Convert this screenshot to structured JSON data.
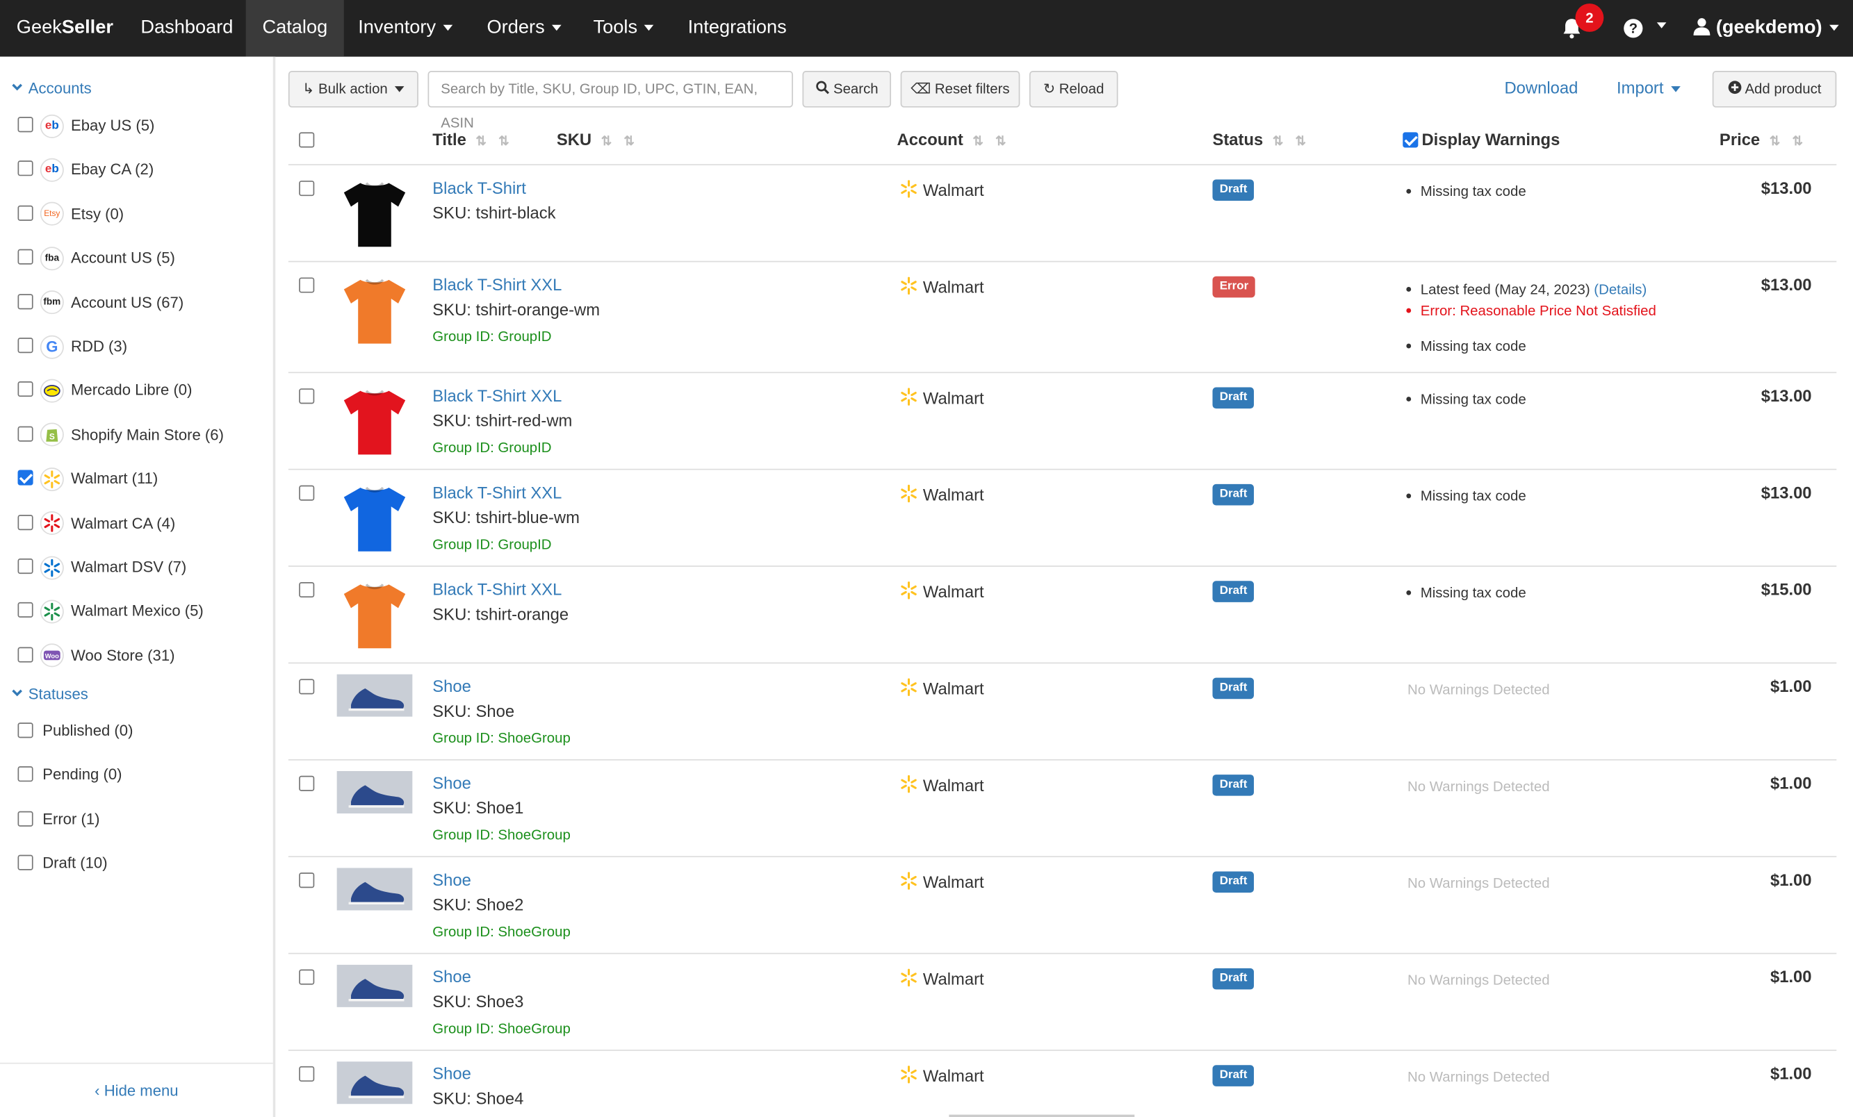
{
  "brand": {
    "part1": "Geek",
    "part2": "Seller"
  },
  "nav": {
    "dashboard": "Dashboard",
    "catalog": "Catalog",
    "inventory": "Inventory",
    "orders": "Orders",
    "tools": "Tools",
    "integrations": "Integrations"
  },
  "notifications": {
    "count": "2"
  },
  "help_icon": "?",
  "user": {
    "name": "(geekdemo)"
  },
  "sidebar": {
    "accounts_heading": "Accounts",
    "accounts": [
      {
        "label": "Ebay US (5)",
        "icon": "ebay-icon",
        "logo_text": "eb",
        "checked": false
      },
      {
        "label": "Ebay CA (2)",
        "icon": "ebay-icon",
        "logo_text": "eb",
        "checked": false
      },
      {
        "label": "Etsy (0)",
        "icon": "etsy-icon",
        "logo_text": "Etsy",
        "checked": false
      },
      {
        "label": "Account US (5)",
        "icon": "fba-icon",
        "logo_text": "fba",
        "checked": false
      },
      {
        "label": "Account US (67)",
        "icon": "fbm-icon",
        "logo_text": "fbm",
        "checked": false
      },
      {
        "label": "RDD (3)",
        "icon": "google-icon",
        "logo_text": "G",
        "checked": false
      },
      {
        "label": "Mercado Libre (0)",
        "icon": "mercado-libre-icon",
        "logo_text": "",
        "checked": false
      },
      {
        "label": "Shopify Main Store (6)",
        "icon": "shopify-icon",
        "logo_text": "",
        "checked": false
      },
      {
        "label": "Walmart (11)",
        "icon": "walmart-icon",
        "logo_text": "",
        "checked": true
      },
      {
        "label": "Walmart CA (4)",
        "icon": "walmart-ca-icon",
        "logo_text": "",
        "checked": false
      },
      {
        "label": "Walmart DSV (7)",
        "icon": "walmart-dsv-icon",
        "logo_text": "",
        "checked": false
      },
      {
        "label": "Walmart Mexico (5)",
        "icon": "walmart-mexico-icon",
        "logo_text": "",
        "checked": false
      },
      {
        "label": "Woo Store (31)",
        "icon": "woo-icon",
        "logo_text": "Woo",
        "checked": false
      }
    ],
    "statuses_heading": "Statuses",
    "statuses": [
      {
        "label": "Published (0)",
        "checked": false
      },
      {
        "label": "Pending (0)",
        "checked": false
      },
      {
        "label": "Error (1)",
        "checked": false
      },
      {
        "label": "Draft (10)",
        "checked": false
      }
    ],
    "hide_menu": "Hide menu"
  },
  "toolbar": {
    "bulk_action": "Bulk action",
    "search_placeholder": "Search by Title, SKU, Group ID, UPC, GTIN, EAN, ASIN",
    "search": "Search",
    "reset_filters": "Reset filters",
    "reload": "Reload",
    "download": "Download",
    "import": "Import",
    "add_product": "Add product"
  },
  "table": {
    "headers": {
      "title": "Title",
      "sku": "SKU",
      "account": "Account",
      "status": "Status",
      "display_warnings": "Display Warnings",
      "price": "Price"
    },
    "display_warnings_checked": true,
    "rows": [
      {
        "thumb": "tshirt-black",
        "color": "#0a0a0a",
        "title": "Black T-Shirt",
        "sku": "SKU: tshirt-black",
        "group": "",
        "account": "Walmart",
        "status": "Draft",
        "warnings": [
          {
            "text": "Missing tax code",
            "type": "normal"
          }
        ],
        "no_warnings": "",
        "price": "$13.00"
      },
      {
        "thumb": "tshirt-orange",
        "color": "#f07a2a",
        "title": "Black T-Shirt XXL",
        "sku": "SKU: tshirt-orange-wm",
        "group": "Group ID: GroupID",
        "account": "Walmart",
        "status": "Error",
        "warnings": [
          {
            "text": "Latest feed (May 24, 2023)",
            "link": "(Details)",
            "type": "normal"
          },
          {
            "text": "Error: Reasonable Price Not Satisfied",
            "type": "red"
          },
          {
            "text": "Missing tax code",
            "type": "normal"
          }
        ],
        "no_warnings": "",
        "price": "$13.00"
      },
      {
        "thumb": "tshirt-red",
        "color": "#e2141e",
        "title": "Black T-Shirt XXL",
        "sku": "SKU: tshirt-red-wm",
        "group": "Group ID: GroupID",
        "account": "Walmart",
        "status": "Draft",
        "warnings": [
          {
            "text": "Missing tax code",
            "type": "normal"
          }
        ],
        "no_warnings": "",
        "price": "$13.00"
      },
      {
        "thumb": "tshirt-blue",
        "color": "#1166e0",
        "title": "Black T-Shirt XXL",
        "sku": "SKU: tshirt-blue-wm",
        "group": "Group ID: GroupID",
        "account": "Walmart",
        "status": "Draft",
        "warnings": [
          {
            "text": "Missing tax code",
            "type": "normal"
          }
        ],
        "no_warnings": "",
        "price": "$13.00"
      },
      {
        "thumb": "tshirt-orange",
        "color": "#f07a2a",
        "title": "Black T-Shirt XXL",
        "sku": "SKU: tshirt-orange",
        "group": "",
        "account": "Walmart",
        "status": "Draft",
        "warnings": [
          {
            "text": "Missing tax code",
            "type": "normal"
          }
        ],
        "no_warnings": "",
        "price": "$15.00"
      },
      {
        "thumb": "shoe",
        "color": "#2c4a8c",
        "title": "Shoe",
        "sku": "SKU: Shoe",
        "group": "Group ID: ShoeGroup",
        "account": "Walmart",
        "status": "Draft",
        "warnings": [],
        "no_warnings": "No Warnings Detected",
        "price": "$1.00"
      },
      {
        "thumb": "shoe",
        "color": "#2c4a8c",
        "title": "Shoe",
        "sku": "SKU: Shoe1",
        "group": "Group ID: ShoeGroup",
        "account": "Walmart",
        "status": "Draft",
        "warnings": [],
        "no_warnings": "No Warnings Detected",
        "price": "$1.00"
      },
      {
        "thumb": "shoe",
        "color": "#2c4a8c",
        "title": "Shoe",
        "sku": "SKU: Shoe2",
        "group": "Group ID: ShoeGroup",
        "account": "Walmart",
        "status": "Draft",
        "warnings": [],
        "no_warnings": "No Warnings Detected",
        "price": "$1.00"
      },
      {
        "thumb": "shoe",
        "color": "#2c4a8c",
        "title": "Shoe",
        "sku": "SKU: Shoe3",
        "group": "Group ID: ShoeGroup",
        "account": "Walmart",
        "status": "Draft",
        "warnings": [],
        "no_warnings": "No Warnings Detected",
        "price": "$1.00"
      },
      {
        "thumb": "shoe",
        "color": "#2c4a8c",
        "title": "Shoe",
        "sku": "SKU: Shoe4",
        "group": "",
        "account": "Walmart",
        "status": "Draft",
        "warnings": [],
        "no_warnings": "No Warnings Detected",
        "price": "$1.00"
      }
    ]
  }
}
